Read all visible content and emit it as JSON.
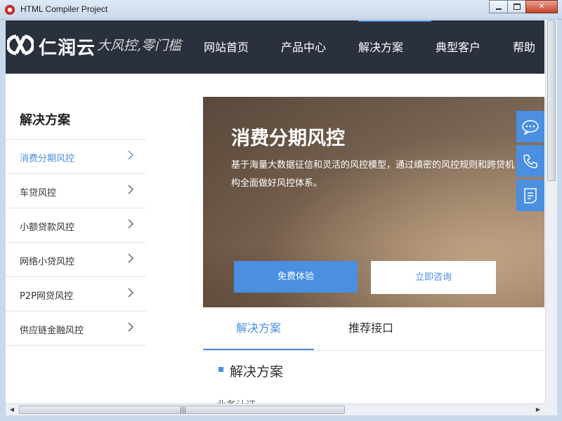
{
  "window": {
    "title": "HTML Compiler Project"
  },
  "header": {
    "logo_text": "仁润云",
    "slogan": "大风控,零门槛",
    "nav": [
      "网站首页",
      "产品中心",
      "解决方案",
      "典型客户",
      "帮助"
    ],
    "active_nav": "解决方案"
  },
  "sidebar": {
    "title": "解决方案",
    "items": [
      {
        "label": "消费分期风控",
        "active": true
      },
      {
        "label": "车贷风控",
        "active": false
      },
      {
        "label": "小额贷款风控",
        "active": false
      },
      {
        "label": "网络小贷风控",
        "active": false
      },
      {
        "label": "P2P网贷风控",
        "active": false
      },
      {
        "label": "供应链金融风控",
        "active": false
      }
    ]
  },
  "banner": {
    "title": "消费分期风控",
    "description": "基于海量大数据征信和灵活的风控模型，通过缜密的风控规则和跨贷机构全面做好风控体系。",
    "primary_button": "免费体验",
    "secondary_button": "立即咨询"
  },
  "float_bar": {
    "icons": [
      "chat-icon",
      "phone-icon",
      "document-icon"
    ]
  },
  "tabs": [
    "解决方案",
    "推荐接口"
  ],
  "section": {
    "title": "解决方案",
    "partial_text": "业务认证"
  },
  "colors": {
    "accent": "#4a8fe0",
    "header_bg": "#2b303f"
  }
}
